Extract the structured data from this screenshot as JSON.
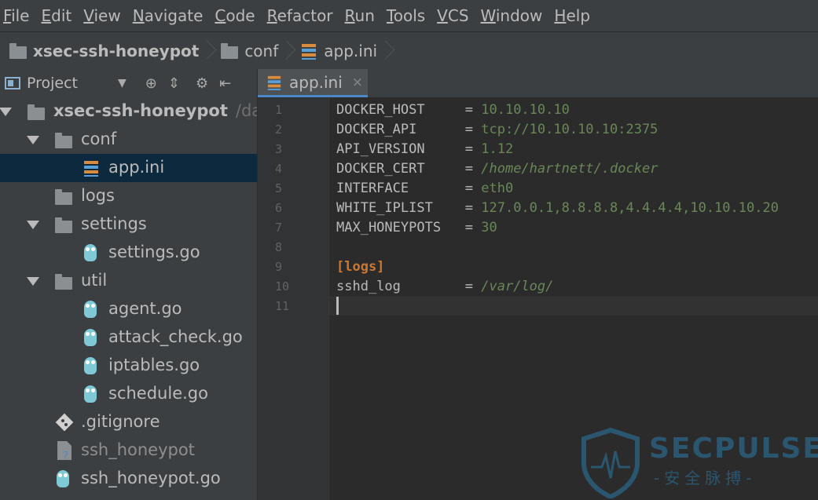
{
  "menu": [
    "File",
    "Edit",
    "View",
    "Navigate",
    "Code",
    "Refactor",
    "Run",
    "Tools",
    "VCS",
    "Window",
    "Help"
  ],
  "breadcrumbs": [
    {
      "label": "xsec-ssh-honeypot",
      "icon": "folder-icon"
    },
    {
      "label": "conf",
      "icon": "folder-icon"
    },
    {
      "label": "app.ini",
      "icon": "ini-file-icon"
    }
  ],
  "project_panel": {
    "title": "Project",
    "tools": [
      "▼",
      "⊕",
      "⇕",
      "⚙",
      "⇤"
    ]
  },
  "tree": [
    {
      "label": "xsec-ssh-honeypot",
      "path": "/data/",
      "type": "folder",
      "expanded": true,
      "depth": 0,
      "bold": true
    },
    {
      "label": "conf",
      "type": "folder",
      "expanded": true,
      "depth": 1
    },
    {
      "label": "app.ini",
      "type": "ini",
      "depth": 2,
      "selected": true
    },
    {
      "label": "logs",
      "type": "folder",
      "expanded": false,
      "depth": 1
    },
    {
      "label": "settings",
      "type": "folder",
      "expanded": true,
      "depth": 1
    },
    {
      "label": "settings.go",
      "type": "go",
      "depth": 2
    },
    {
      "label": "util",
      "type": "folder",
      "expanded": true,
      "depth": 1
    },
    {
      "label": "agent.go",
      "type": "go",
      "depth": 2
    },
    {
      "label": "attack_check.go",
      "type": "go",
      "depth": 2
    },
    {
      "label": "iptables.go",
      "type": "go",
      "depth": 2
    },
    {
      "label": "schedule.go",
      "type": "go",
      "depth": 2
    },
    {
      "label": ".gitignore",
      "type": "git",
      "depth": 1
    },
    {
      "label": "ssh_honeypot",
      "type": "unknown",
      "depth": 1,
      "gray": true
    },
    {
      "label": "ssh_honeypot.go",
      "type": "go",
      "depth": 1
    }
  ],
  "tab": {
    "label": "app.ini",
    "close": "×"
  },
  "editor": {
    "lines": [
      {
        "n": "1",
        "key": "DOCKER_HOST     ",
        "eq": "= ",
        "value": "10.10.10.10",
        "style": "val"
      },
      {
        "n": "2",
        "key": "DOCKER_API      ",
        "eq": "= ",
        "value": "tcp://10.10.10.10:2375",
        "style": "val"
      },
      {
        "n": "3",
        "key": "API_VERSION     ",
        "eq": "= ",
        "value": "1.12",
        "style": "val"
      },
      {
        "n": "4",
        "key": "DOCKER_CERT     ",
        "eq": "= ",
        "value": "/home/hartnett/.docker",
        "style": "path"
      },
      {
        "n": "5",
        "key": "INTERFACE       ",
        "eq": "= ",
        "value": "eth0",
        "style": "val"
      },
      {
        "n": "6",
        "key": "WHITE_IPLIST    ",
        "eq": "= ",
        "value": "127.0.0.1,8.8.8.8,4.4.4.4,10.10.10.20",
        "style": "val"
      },
      {
        "n": "7",
        "key": "MAX_HONEYPOTS   ",
        "eq": "= ",
        "value": "30",
        "style": "val"
      },
      {
        "n": "8",
        "key": "",
        "eq": "",
        "value": "",
        "style": "val"
      },
      {
        "n": "9",
        "key": "",
        "eq": "",
        "value": "[logs]",
        "style": "section"
      },
      {
        "n": "10",
        "key": "sshd_log        ",
        "eq": "= ",
        "value": "/var/log/",
        "style": "path"
      },
      {
        "n": "11",
        "key": "",
        "eq": "",
        "value": "",
        "style": "val"
      }
    ]
  },
  "watermark": {
    "title": "SECPULSE",
    "subtitle": "-安全脉搏-"
  },
  "colors": {
    "selection": "#0d293e",
    "editor_bg": "#2b2b2b",
    "string": "#6a8759",
    "section": "#cc7832"
  }
}
